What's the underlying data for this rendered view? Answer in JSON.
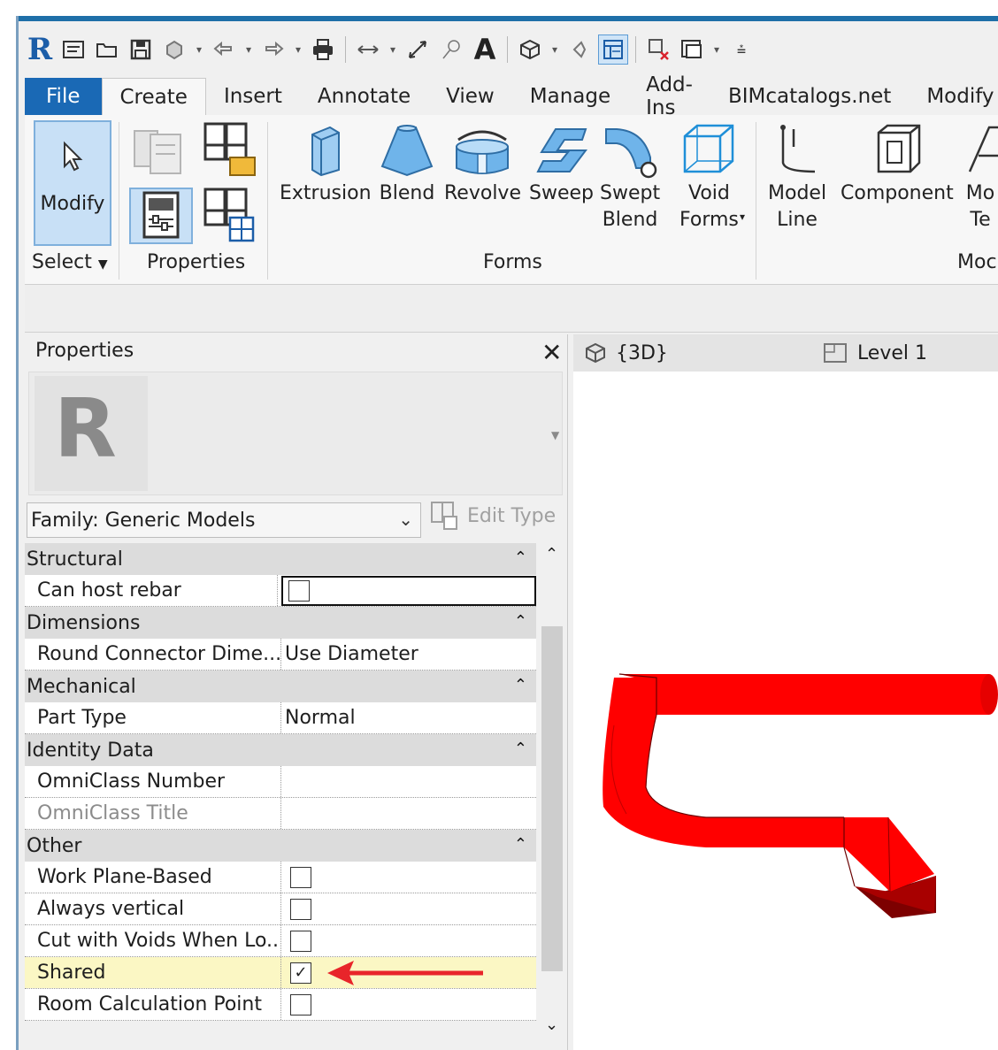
{
  "qat": {
    "logo": "R"
  },
  "tabs": [
    {
      "label": "File"
    },
    {
      "label": "Create"
    },
    {
      "label": "Insert"
    },
    {
      "label": "Annotate"
    },
    {
      "label": "View"
    },
    {
      "label": "Manage"
    },
    {
      "label": "Add-Ins"
    },
    {
      "label": "BIMcatalogs.net"
    },
    {
      "label": "Modify"
    }
  ],
  "ribbon": {
    "modify_label": "Modify",
    "select_label": "Select",
    "properties_panel_label": "Properties",
    "forms_panel_label": "Forms",
    "model_panel_label": "Moc",
    "forms": {
      "extrusion": "Extrusion",
      "blend": "Blend",
      "revolve": "Revolve",
      "sweep": "Sweep",
      "swept_blend_1": "Swept",
      "swept_blend_2": "Blend",
      "void_forms_1": "Void",
      "void_forms_2": "Forms"
    },
    "model": {
      "model_line_1": "Model",
      "model_line_2": "Line",
      "component": "Component",
      "model_text_1": "Mo",
      "model_text_2": "Te"
    }
  },
  "properties": {
    "title": "Properties",
    "family_selector": "Family: Generic Models",
    "edit_type": "Edit Type",
    "groups": {
      "structural": "Structural",
      "dimensions": "Dimensions",
      "mechanical": "Mechanical",
      "identity": "Identity Data",
      "other": "Other"
    },
    "rows": {
      "can_host_rebar": "Can host rebar",
      "round_connector": "Round Connector Dime...",
      "round_connector_value": "Use Diameter",
      "part_type": "Part Type",
      "part_type_value": "Normal",
      "omniclass_number": "OmniClass Number",
      "omniclass_title": "OmniClass Title",
      "work_plane_based": "Work Plane-Based",
      "always_vertical": "Always vertical",
      "cut_with_voids": "Cut with Voids When Lo...",
      "shared": "Shared",
      "room_calc_point": "Room Calculation Point"
    }
  },
  "view_tabs": [
    {
      "label": "{3D}"
    },
    {
      "label": "Level 1"
    }
  ],
  "colors": {
    "file_tab": "#1a69b5",
    "model": "#ff0000",
    "highlight": "#fbf7c4",
    "arrow": "#e8252a"
  }
}
